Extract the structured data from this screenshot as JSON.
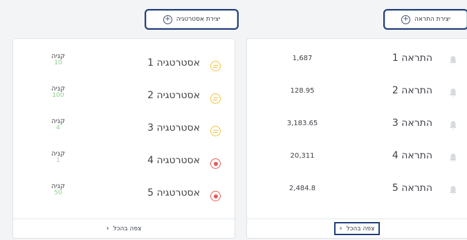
{
  "strategies_panel": {
    "create_button_label": "יצירת אסטרטגיה",
    "see_all_label": "צפה בהכל",
    "items": [
      {
        "name": "אסטרטגיה 1",
        "action": "קניה",
        "count": "10",
        "status": "pending",
        "count_color": "green"
      },
      {
        "name": "אסטרטגיה 2",
        "action": "קניה",
        "count": "100",
        "status": "pending",
        "count_color": "green"
      },
      {
        "name": "אסטרטגיה 3",
        "action": "קניה",
        "count": "4",
        "status": "pending",
        "count_color": "green"
      },
      {
        "name": "אסטרטגיה 4",
        "action": "קניה",
        "count": "1",
        "status": "stopped",
        "count_color": "grey"
      },
      {
        "name": "אסטרטגיה 5",
        "action": "קניה",
        "count": "50",
        "status": "stopped",
        "count_color": "green"
      }
    ]
  },
  "alerts_panel": {
    "create_button_label": "יצירת התראה",
    "see_all_label": "צפה בהכל",
    "items": [
      {
        "name": "התראה 1",
        "value": "1,687"
      },
      {
        "name": "התראה 2",
        "value": "128.95"
      },
      {
        "name": "התראה 3",
        "value": "3,183.65"
      },
      {
        "name": "התראה 4",
        "value": "20,311"
      },
      {
        "name": "התראה 5",
        "value": "2,484.8"
      }
    ]
  },
  "colors": {
    "pending_status": "#f2c23a",
    "stopped_status": "#e35b5b",
    "count_green": "#8ccf8a",
    "highlight_outline": "#1f3d7a"
  },
  "icons": {
    "create": "plus-circle-icon",
    "pending": "pending-status-icon",
    "stopped": "stopped-status-icon",
    "alert": "bell-icon",
    "see_all": "chevron-left-icon"
  }
}
